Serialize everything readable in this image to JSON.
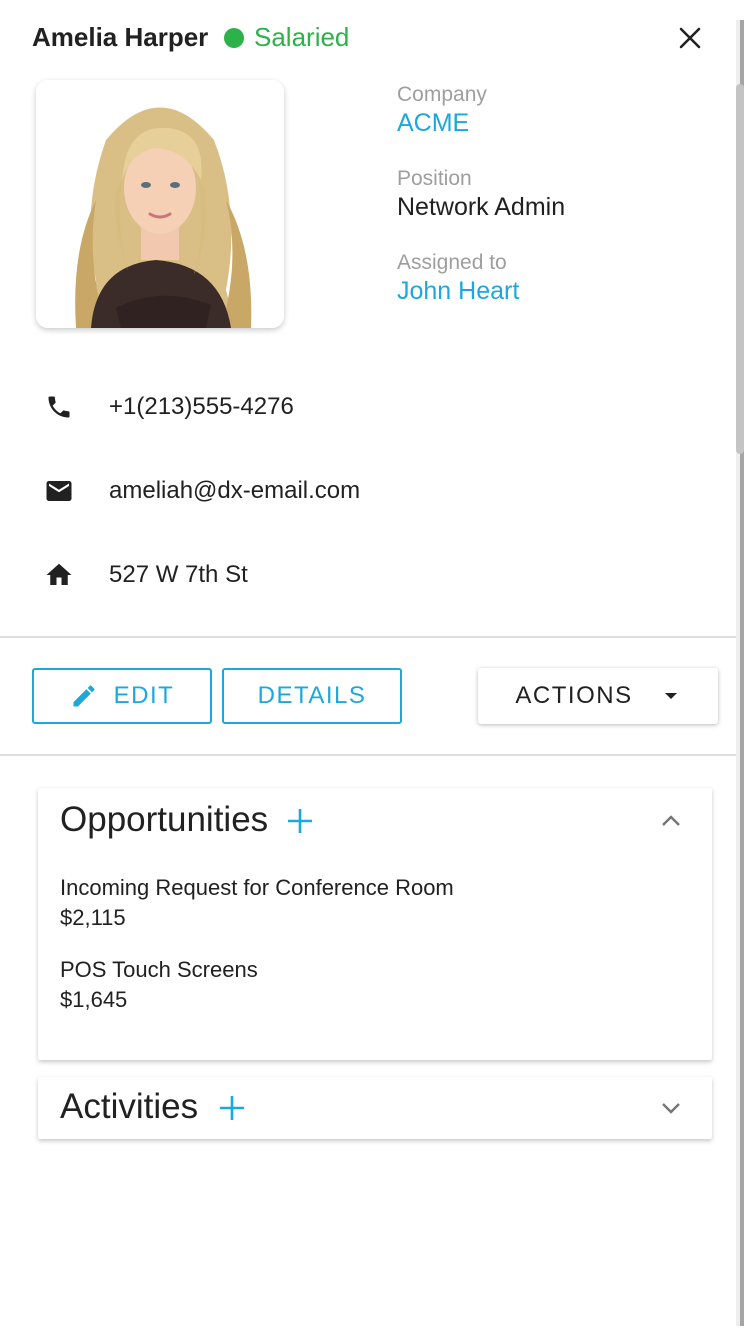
{
  "contact": {
    "name": "Amelia Harper",
    "status": "Salaried",
    "status_color": "#2db24a"
  },
  "info": {
    "company_label": "Company",
    "company_value": "ACME",
    "position_label": "Position",
    "position_value": "Network Admin",
    "assigned_label": "Assigned to",
    "assigned_value": "John Heart"
  },
  "contacts": {
    "phone": "+1(213)555-4276",
    "email": "ameliah@dx-email.com",
    "address": "527 W 7th St"
  },
  "buttons": {
    "edit": "EDIT",
    "details": "DETAILS",
    "actions": "ACTIONS"
  },
  "opportunities": {
    "title": "Opportunities",
    "items": [
      {
        "name": "Incoming Request for Conference Room",
        "amount": "$2,115"
      },
      {
        "name": "POS Touch Screens",
        "amount": "$1,645"
      }
    ]
  },
  "activities": {
    "title": "Activities"
  },
  "icons": {
    "close": "close-icon",
    "phone": "phone-icon",
    "email": "email-icon",
    "home": "home-icon",
    "edit": "pencil-icon",
    "actions": "caret-down-icon",
    "add": "plus-icon",
    "collapse": "chevron-up-icon",
    "expand": "chevron-down-icon"
  },
  "colors": {
    "accent": "#1ca8dd",
    "status": "#2db24a",
    "text": "#212121",
    "muted": "#9e9e9e"
  }
}
